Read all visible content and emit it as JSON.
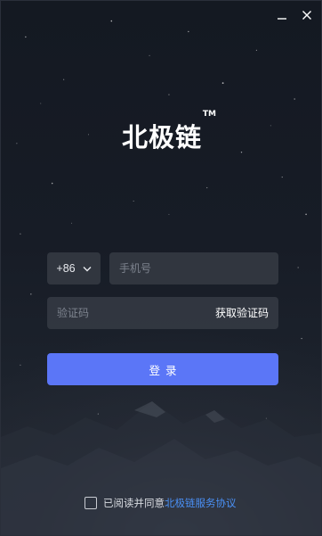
{
  "window": {
    "minimize_icon": "minimize-icon",
    "close_icon": "close-icon"
  },
  "logo": {
    "text": "北极链",
    "trademark": "TM"
  },
  "form": {
    "country_code": "+86",
    "country_code_icon": "chevron-down-icon",
    "phone_placeholder": "手机号",
    "phone_value": "",
    "code_placeholder": "验证码",
    "code_value": "",
    "get_code_label": "获取验证码",
    "login_label": "登录"
  },
  "agreement": {
    "checked": false,
    "text": "已阅读并同意",
    "link_text": "北极链服务协议"
  },
  "colors": {
    "primary": "#5b76f7",
    "link": "#4a90f5",
    "field_bg": "#383d47",
    "background": "#171c26"
  }
}
